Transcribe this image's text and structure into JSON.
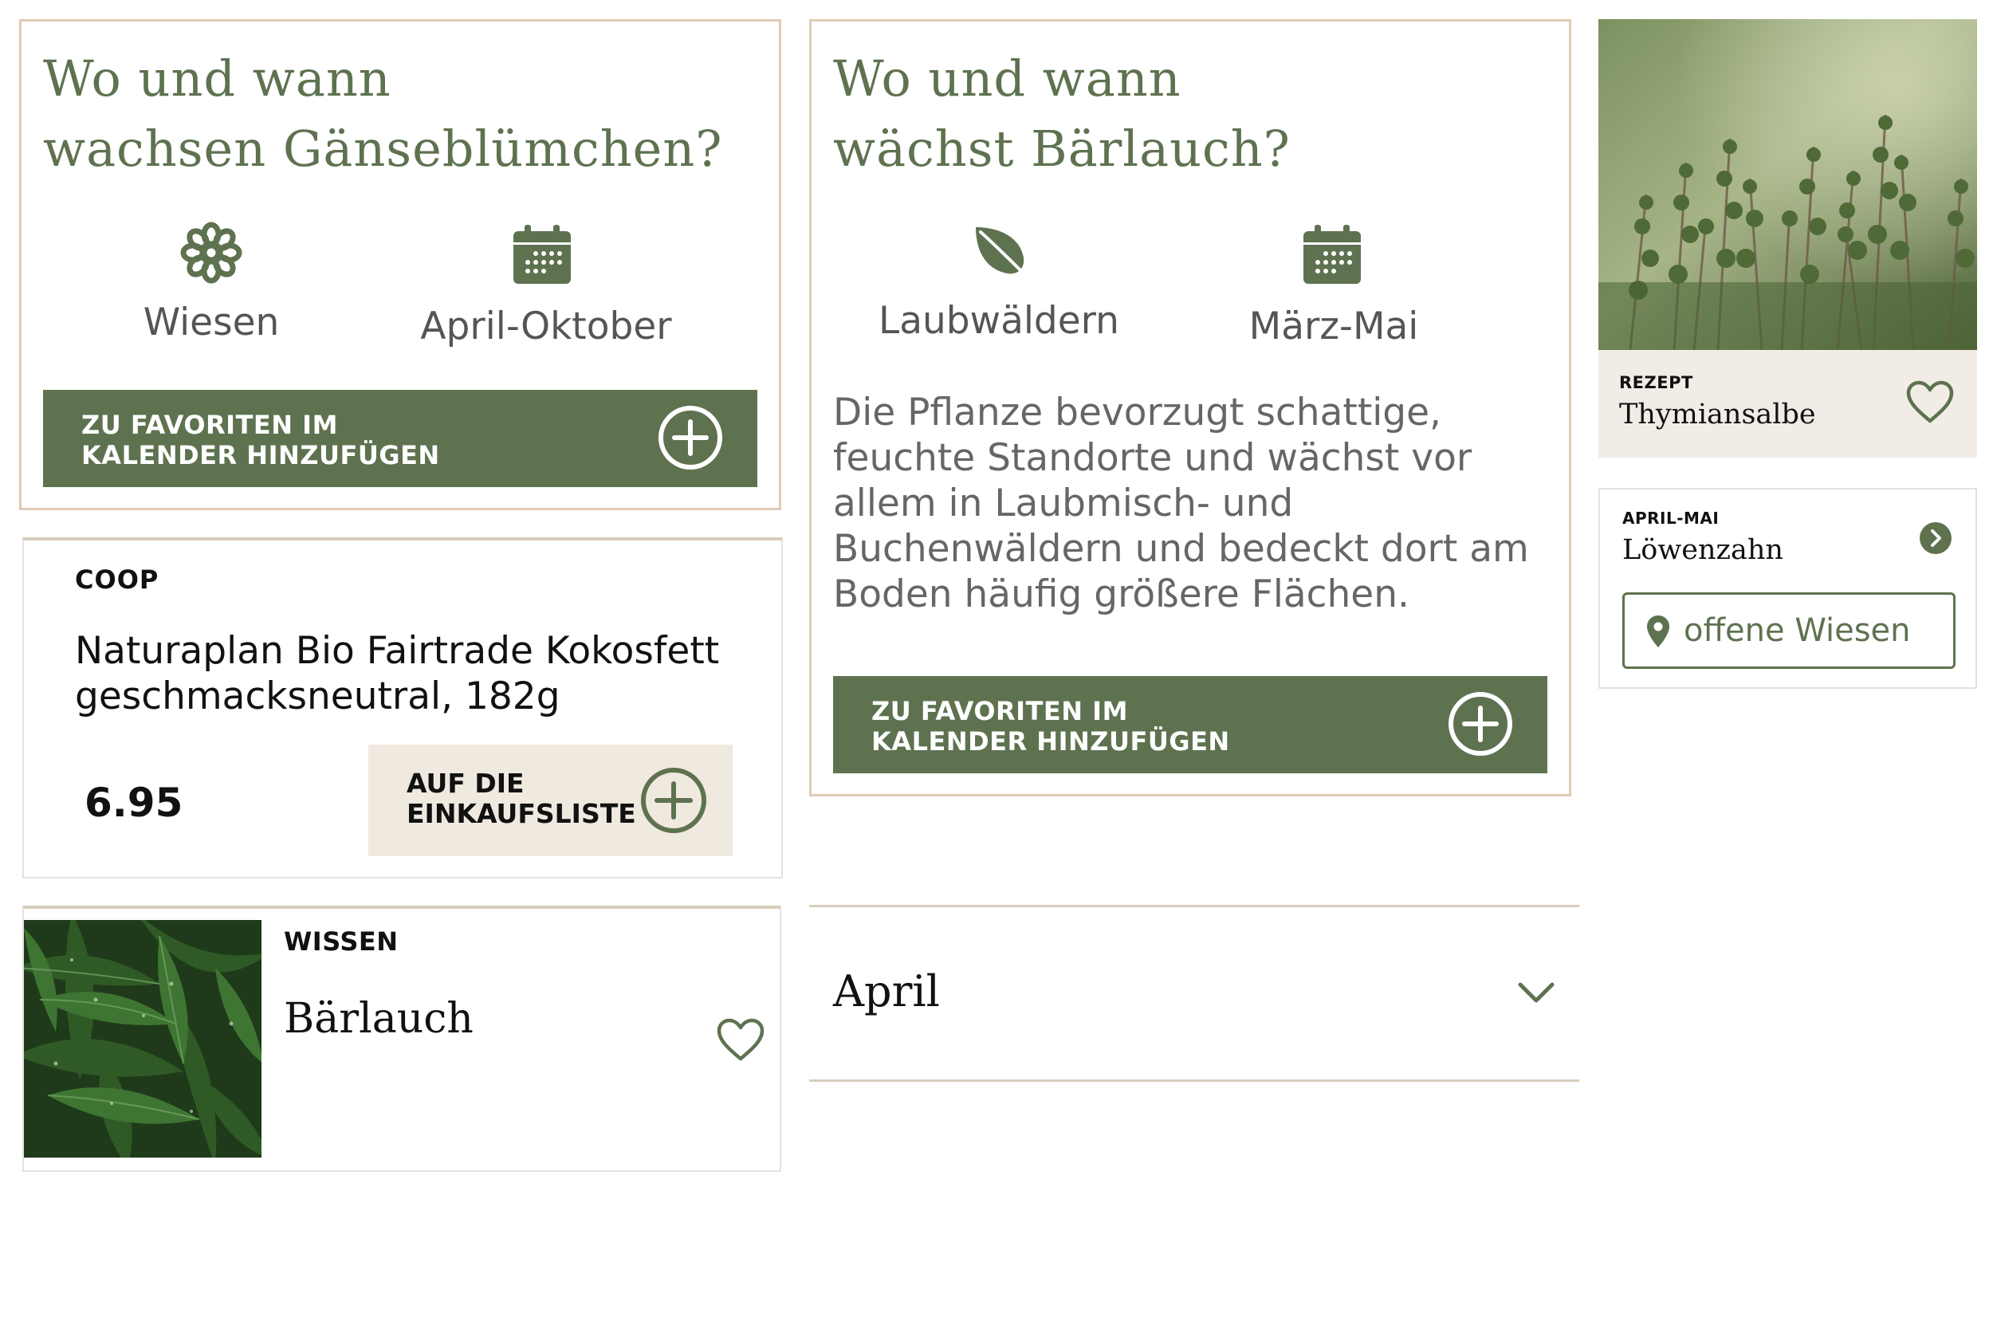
{
  "card_daisy": {
    "title_line1": "Wo und wann",
    "title_line2": "wachsen Gänseblümchen?",
    "location": "Wiesen",
    "season": "April-Oktober",
    "location_icon": "flower-icon",
    "season_icon": "calendar-icon",
    "button_line1": "ZU FAVORITEN IM",
    "button_line2": "KALENDER HINZUFÜGEN"
  },
  "card_barlauch": {
    "title_line1": "Wo und wann",
    "title_line2": "wächst Bärlauch?",
    "location": "Laubwäldern",
    "season": "März-Mai",
    "location_icon": "leaf-icon",
    "season_icon": "calendar-icon",
    "description_lines": [
      "Die Pflanze bevorzugt schattige,",
      "feuchte Standorte und wächst vor",
      "allem in Laubmisch- und",
      "Buchenwäldern und bedeckt dort am",
      "Boden häufig größere Flächen."
    ],
    "button_line1": "ZU FAVORITEN IM",
    "button_line2": "KALENDER HINZUFÜGEN"
  },
  "product_card": {
    "brand": "COOP",
    "name_line1": "Naturaplan Bio Fairtrade Kokosfett",
    "name_line2": "geschmacksneutral, 182g",
    "price": "6.95",
    "button_line1": "AUF DIE",
    "button_line2": "EINKAUFSLISTE"
  },
  "knowledge_card": {
    "category": "WISSEN",
    "title": "Bärlauch"
  },
  "accordion": {
    "label": "April"
  },
  "recipe_card": {
    "category": "REZEPT",
    "title": "Thymiansalbe"
  },
  "season_card": {
    "period": "APRIL-MAI",
    "title": "Löwenzahn",
    "location_button": "offene Wiesen"
  },
  "colors": {
    "brand_green": "#5e7250",
    "beige_border": "#dfcbb5",
    "beige_fill": "#efe9df"
  }
}
